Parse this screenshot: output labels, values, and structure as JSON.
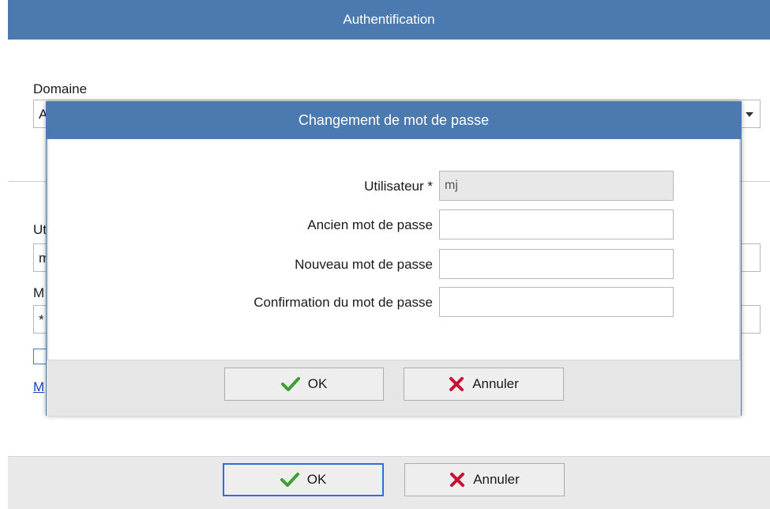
{
  "background_window": {
    "title": "Authentification",
    "domain_label": "Domaine",
    "domain_value": "A",
    "user_label": "Ut",
    "user_value": "m",
    "password_label": "M",
    "password_value": "*",
    "link_text": "M",
    "ok_label": "OK",
    "cancel_label": "Annuler"
  },
  "dialog": {
    "title": "Changement de mot de passe",
    "fields": [
      {
        "label": "Utilisateur *",
        "value": "mj",
        "readonly": true
      },
      {
        "label": "Ancien mot de passe",
        "value": ""
      },
      {
        "label": "Nouveau mot de passe",
        "value": ""
      },
      {
        "label": "Confirmation du mot de passe",
        "value": ""
      }
    ],
    "ok_label": "OK",
    "cancel_label": "Annuler"
  },
  "colors": {
    "titlebar": "#4a7ab0",
    "ok_check": "#3aa02e",
    "cancel_x": "#c8102e",
    "focus_border": "#2f6fd1"
  },
  "icons": {
    "ok": "checkmark-icon",
    "cancel": "x-icon",
    "combo": "chevron-down-icon"
  }
}
